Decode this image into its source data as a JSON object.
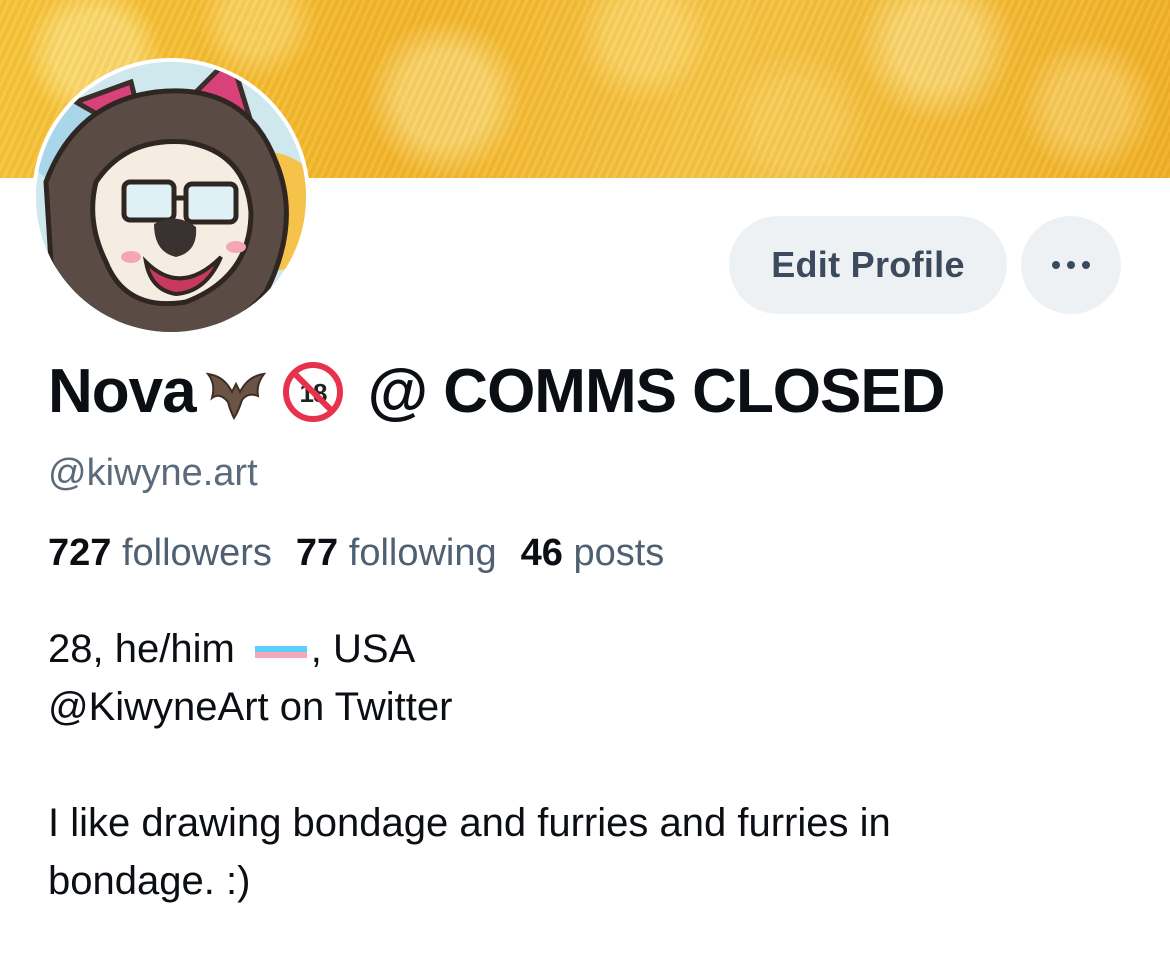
{
  "profile": {
    "display_name": "Nova",
    "display_name_suffix": "@ COMMS CLOSED",
    "handle": "@kiwyne.art",
    "icons": [
      "bat-emoji",
      "no-under-18-emoji"
    ]
  },
  "actions": {
    "edit_profile_label": "Edit Profile",
    "more_icon": "ellipsis-icon"
  },
  "stats": {
    "followers_count": "727",
    "followers_label": "followers",
    "following_count": "77",
    "following_label": "following",
    "posts_count": "46",
    "posts_label": "posts"
  },
  "bio": {
    "line1_before_flag": "28, he/him",
    "line1_after_flag": ", USA",
    "line2": "@KiwyneArt on Twitter",
    "line3": "I like drawing bondage and furries and furries in",
    "line4": "bondage. :)"
  },
  "colors": {
    "banner": "#f6bd33",
    "button_bg": "#eef1f4",
    "secondary_text": "#5b6b7c"
  }
}
